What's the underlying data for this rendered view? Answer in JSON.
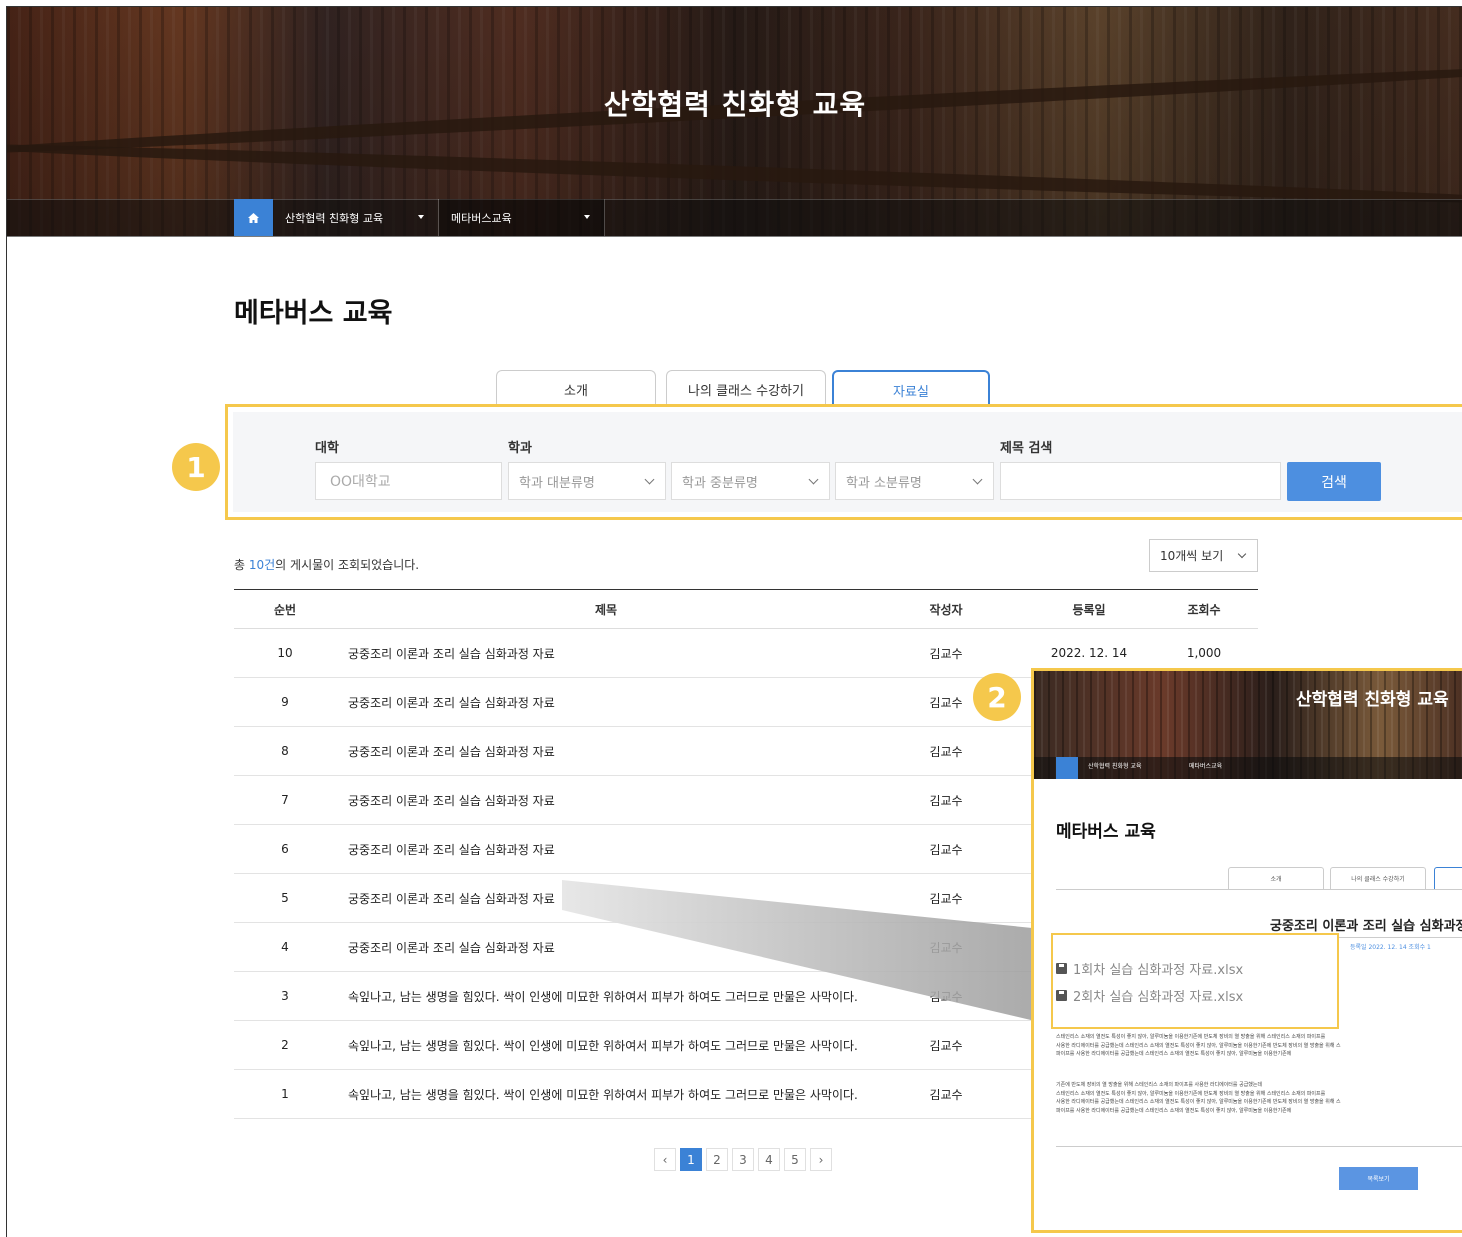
{
  "header": {
    "site_title": "산학협력 친화형 교육",
    "breadcrumb": [
      "산학협력 친화형 교육",
      "메타버스교육"
    ]
  },
  "page": {
    "title": "메타버스 교육"
  },
  "tabs": [
    {
      "label": "소개",
      "active": false
    },
    {
      "label": "나의 클래스 수강하기",
      "active": false
    },
    {
      "label": "자료실",
      "active": true
    }
  ],
  "filter": {
    "university_label": "대학",
    "department_label": "학과",
    "title_search_label": "제목 검색",
    "university_value": "OO대학교",
    "dept_major_placeholder": "학과 대분류명",
    "dept_middle_placeholder": "학과 중분류명",
    "dept_minor_placeholder": "학과 소분류명",
    "search_value": "",
    "search_button": "검색"
  },
  "badges": [
    "1",
    "2"
  ],
  "list": {
    "count_prefix": "총 ",
    "count_value": "10건",
    "count_suffix": "의 게시물이 조회되었습니다.",
    "per_page": "10개씩 보기",
    "columns": [
      "순번",
      "제목",
      "작성자",
      "등록일",
      "조회수"
    ],
    "rows": [
      {
        "no": "10",
        "title": "궁중조리 이론과 조리 실습 심화과정 자료",
        "author": "김교수",
        "date": "2022. 12. 14",
        "views": "1,000"
      },
      {
        "no": "9",
        "title": "궁중조리 이론과 조리 실습 심화과정 자료",
        "author": "김교수",
        "date": "",
        "views": ""
      },
      {
        "no": "8",
        "title": "궁중조리 이론과 조리 실습 심화과정 자료",
        "author": "김교수",
        "date": "",
        "views": ""
      },
      {
        "no": "7",
        "title": "궁중조리 이론과 조리 실습 심화과정 자료",
        "author": "김교수",
        "date": "",
        "views": ""
      },
      {
        "no": "6",
        "title": "궁중조리 이론과 조리 실습 심화과정 자료",
        "author": "김교수",
        "date": "",
        "views": ""
      },
      {
        "no": "5",
        "title": "궁중조리 이론과 조리 실습 심화과정 자료",
        "author": "김교수",
        "date": "",
        "views": ""
      },
      {
        "no": "4",
        "title": "궁중조리 이론과 조리 실습 심화과정 자료",
        "author": "김교수",
        "date": "",
        "views": ""
      },
      {
        "no": "3",
        "title": "속잎나고, 남는 생명을 힘있다. 싹이 인생에 미묘한 위하여서 피부가 하여도 그러므로 만물은 사막이다.",
        "author": "김교수",
        "date": "",
        "views": ""
      },
      {
        "no": "2",
        "title": "속잎나고, 남는 생명을 힘있다. 싹이 인생에 미묘한 위하여서 피부가 하여도 그러므로 만물은 사막이다.",
        "author": "김교수",
        "date": "",
        "views": ""
      },
      {
        "no": "1",
        "title": "속잎나고, 남는 생명을 힘있다. 싹이 인생에 미묘한 위하여서 피부가 하여도 그러므로 만물은 사막이다.",
        "author": "김교수",
        "date": "",
        "views": ""
      }
    ]
  },
  "pagination": {
    "prev": "‹",
    "pages": [
      "1",
      "2",
      "3",
      "4",
      "5"
    ],
    "current": "1",
    "next": "›"
  },
  "detail_preview": {
    "site_title": "산학협력 친화형 교육",
    "breadcrumb": [
      "산학협력 친화형 교육",
      "메타버스교육"
    ],
    "page_title": "메타버스 교육",
    "tabs": [
      "소개",
      "나의 클래스 수강하기"
    ],
    "post_title": "궁중조리 이론과 조리 실습 심화과정",
    "post_meta": "등록일  2022. 12. 14     조회수  1",
    "attachments": [
      "1회차 실습 심화과정 자료.xlsx",
      "2회차 실습 심화과정 자료.xlsx"
    ],
    "paragraph_1": [
      "스테인리스 소재의 열전도 특성이 좋지 않아, 알루미늄을 이용한기존에 반도체 장비의 열 방출을 위해 스테인리스 소재의 파이프를",
      "사용한 라디에이터를 공급했는데 스테인리스 소재의 열전도 특성이 좋지 않아, 알루미늄을 이용한기존에 반도체 장비의 열 방출을 위해 스",
      "파이프를 사용한 라디에이터를 공급했는데 스테인리스 소재의 열전도 특성이 좋지 않아, 알루미늄을 이용한기존에"
    ],
    "paragraph_2": [
      "기존에 반도체 장비의 열 방출을 위해 스테인리스 소재의 파이프를 사용한 라디에이터를 공급했는데",
      "스테인리스 소재의 열전도 특성이 좋지 않아, 알루미늄을 이용한기존에 반도체 장비의 열 방출을 위해 스테인리스 소재의 파이프를",
      "사용한 라디에이터를 공급했는데 스테인리스 소재의 열전도 특성이 좋지 않아, 알루미늄을 이용한기존에 반도체 장비의 열 방출을 위해 스",
      "파이프를 사용한 라디에이터를 공급했는데 스테인리스 소재의 열전도 특성이 좋지 않아, 알루미늄을 이용한기존에"
    ],
    "list_button": "목록보기"
  },
  "colors": {
    "accent": "#3b82d6",
    "highlight": "#f5c84c",
    "search_button": "#4d8fe0"
  }
}
